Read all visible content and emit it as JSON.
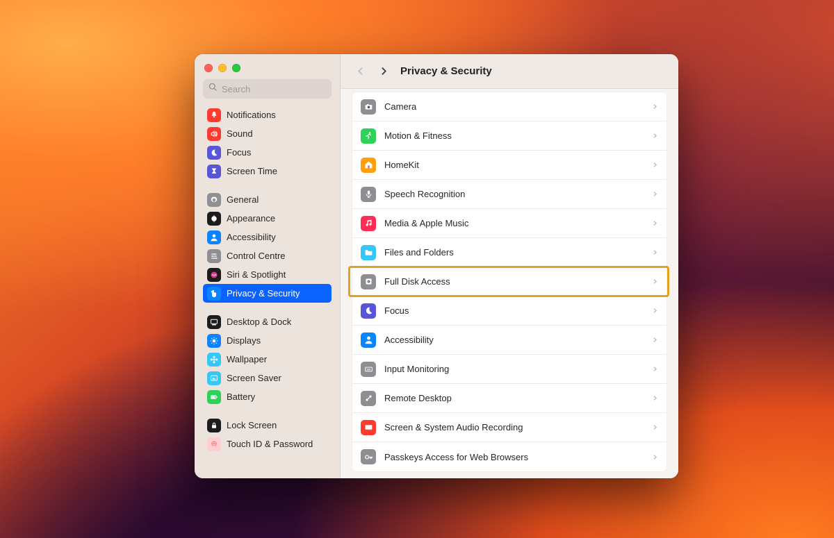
{
  "window": {
    "title": "Privacy & Security",
    "search_placeholder": "Search"
  },
  "sidebar": {
    "groups": [
      {
        "items": [
          {
            "id": "notifications",
            "label": "Notifications",
            "icon": "bell",
            "color": "#ff3b30"
          },
          {
            "id": "sound",
            "label": "Sound",
            "icon": "speaker",
            "color": "#ff3b30"
          },
          {
            "id": "focus",
            "label": "Focus",
            "icon": "moon",
            "color": "#5856d6"
          },
          {
            "id": "screen-time",
            "label": "Screen Time",
            "icon": "hourglass",
            "color": "#5856d6"
          }
        ]
      },
      {
        "items": [
          {
            "id": "general",
            "label": "General",
            "icon": "gear",
            "color": "#8e8e93"
          },
          {
            "id": "appearance",
            "label": "Appearance",
            "icon": "appearance",
            "color": "#1c1c1e"
          },
          {
            "id": "accessibility",
            "label": "Accessibility",
            "icon": "person",
            "color": "#0a84ff"
          },
          {
            "id": "control-centre",
            "label": "Control Centre",
            "icon": "sliders",
            "color": "#8e8e93"
          },
          {
            "id": "siri",
            "label": "Siri & Spotlight",
            "icon": "siri",
            "color": "#1c1c1e"
          },
          {
            "id": "privacy",
            "label": "Privacy & Security",
            "icon": "hand",
            "color": "#0a84ff",
            "selected": true
          }
        ]
      },
      {
        "items": [
          {
            "id": "desktop-dock",
            "label": "Desktop & Dock",
            "icon": "dock",
            "color": "#1c1c1e"
          },
          {
            "id": "displays",
            "label": "Displays",
            "icon": "sun",
            "color": "#0a84ff"
          },
          {
            "id": "wallpaper",
            "label": "Wallpaper",
            "icon": "flower",
            "color": "#34c7f7"
          },
          {
            "id": "screen-saver",
            "label": "Screen Saver",
            "icon": "screensaver",
            "color": "#34c7f7"
          },
          {
            "id": "battery",
            "label": "Battery",
            "icon": "battery",
            "color": "#30d158"
          }
        ]
      },
      {
        "items": [
          {
            "id": "lock-screen",
            "label": "Lock Screen",
            "icon": "lock",
            "color": "#1c1c1e"
          },
          {
            "id": "touch-id",
            "label": "Touch ID & Password",
            "icon": "fingerprint",
            "color": "#ffcdd2"
          }
        ]
      }
    ]
  },
  "main": {
    "rows": [
      {
        "id": "camera",
        "label": "Camera",
        "icon": "camera",
        "color": "#8e8e93"
      },
      {
        "id": "motion",
        "label": "Motion & Fitness",
        "icon": "runner",
        "color": "#30d158"
      },
      {
        "id": "homekit",
        "label": "HomeKit",
        "icon": "house",
        "color": "#ff9f0a"
      },
      {
        "id": "speech",
        "label": "Speech Recognition",
        "icon": "mic",
        "color": "#8e8e93"
      },
      {
        "id": "media",
        "label": "Media & Apple Music",
        "icon": "music",
        "color": "#ff2d55"
      },
      {
        "id": "files",
        "label": "Files and Folders",
        "icon": "folder",
        "color": "#34c7f7"
      },
      {
        "id": "full-disk",
        "label": "Full Disk Access",
        "icon": "disk",
        "color": "#8e8e93",
        "highlighted": true
      },
      {
        "id": "focus",
        "label": "Focus",
        "icon": "moon",
        "color": "#5856d6"
      },
      {
        "id": "accessibility",
        "label": "Accessibility",
        "icon": "person",
        "color": "#0a84ff"
      },
      {
        "id": "input-monitoring",
        "label": "Input Monitoring",
        "icon": "keyboard",
        "color": "#8e8e93"
      },
      {
        "id": "remote-desktop",
        "label": "Remote Desktop",
        "icon": "remote",
        "color": "#8e8e93"
      },
      {
        "id": "screen-audio",
        "label": "Screen & System Audio Recording",
        "icon": "record",
        "color": "#ff3b30"
      },
      {
        "id": "passkeys",
        "label": "Passkeys Access for Web Browsers",
        "icon": "key",
        "color": "#8e8e93"
      }
    ]
  },
  "annotation": {
    "highlight_color": "#e1a21d"
  }
}
